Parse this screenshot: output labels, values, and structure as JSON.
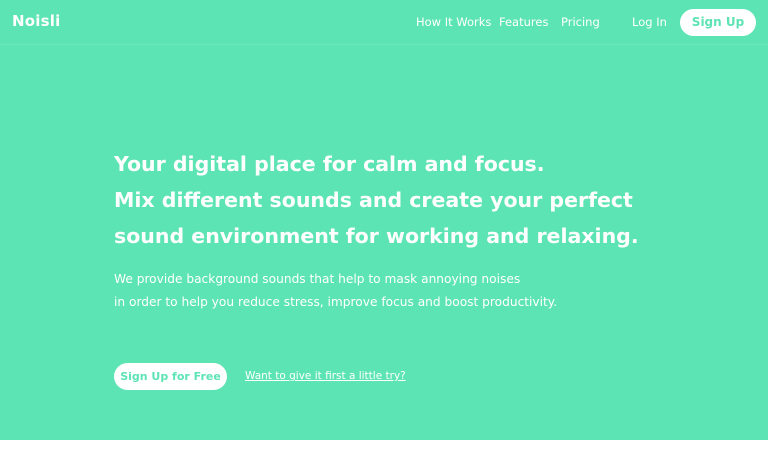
{
  "colors": {
    "brand": "#5ce4b4",
    "text_on_brand": "#ffffff",
    "below_hero": "#ffffff"
  },
  "header": {
    "logo": "Noisli",
    "nav": {
      "how_it_works": "How It Works",
      "features": "Features",
      "pricing": "Pricing"
    },
    "login": "Log In",
    "signup": "Sign Up"
  },
  "hero": {
    "headline": [
      "Your digital place for calm and focus.",
      "Mix different sounds and create your perfect",
      "sound environment for working and relaxing."
    ],
    "subtext": [
      "We provide background sounds that help to mask annoying noises",
      "in order to help you reduce stress, improve focus and boost productivity."
    ],
    "cta_primary": "Sign Up for Free",
    "cta_secondary": "Want to give it first a little try?"
  }
}
